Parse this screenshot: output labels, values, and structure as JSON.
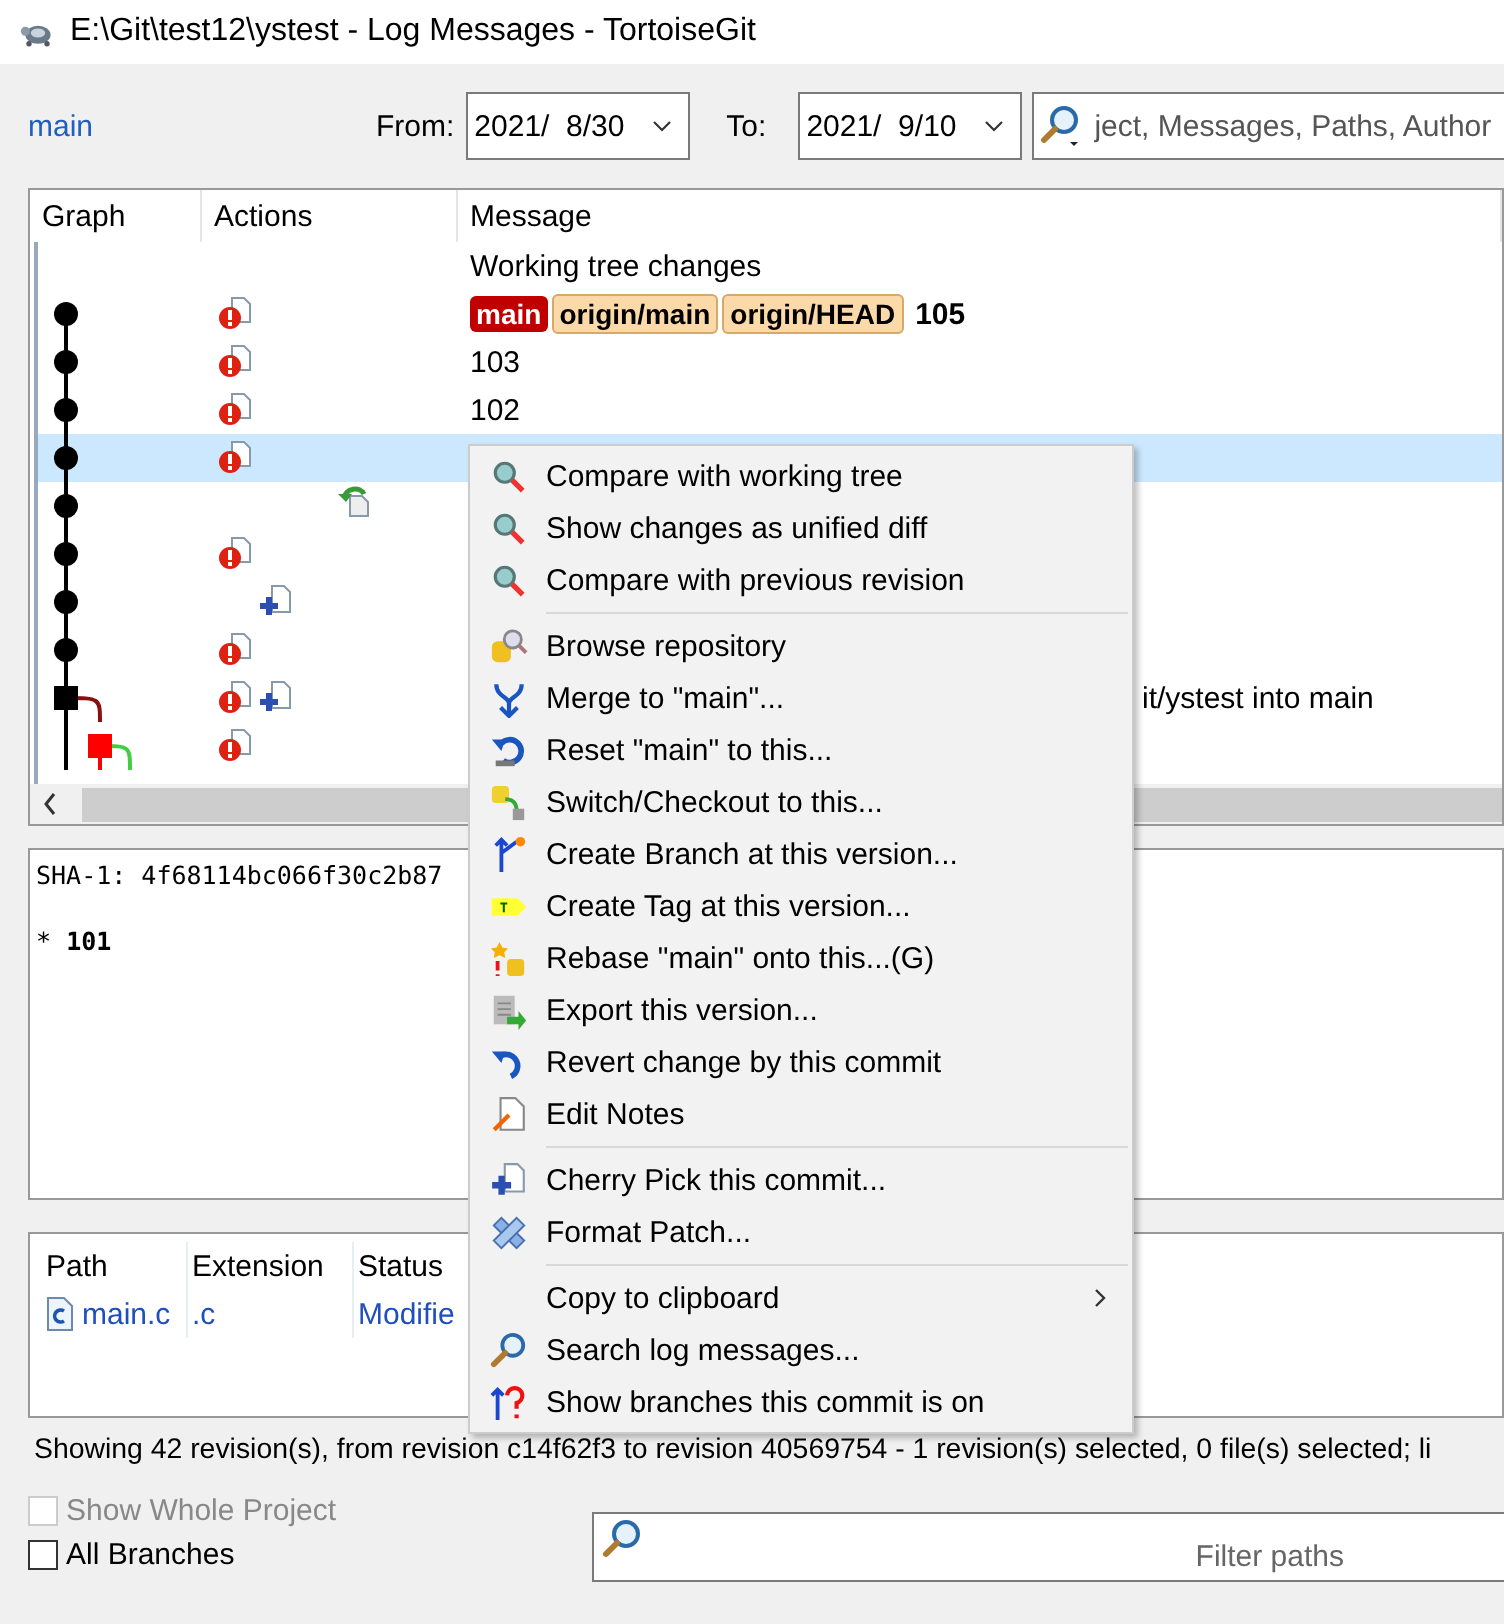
{
  "window": {
    "title": "E:\\Git\\test12\\ystest - Log Messages - TortoiseGit"
  },
  "toolbar": {
    "branch": "main",
    "from_label": "From:",
    "from_date": "2021/  8/30",
    "to_label": "To:",
    "to_date": "2021/  9/10",
    "search": {
      "placeholder": "ject, Messages, Paths, Author"
    }
  },
  "log": {
    "columns": [
      "Graph",
      "Actions",
      "Message"
    ],
    "rows": [
      {
        "kind": "working",
        "selected": false,
        "actions": [],
        "message": "Working tree changes",
        "refs": []
      },
      {
        "kind": "dot",
        "selected": false,
        "actions": [
          {
            "kind": "modify"
          }
        ],
        "message": "105",
        "refs": [
          {
            "label": "main",
            "kind": "local"
          },
          {
            "label": "origin/main",
            "kind": "remote"
          },
          {
            "label": "origin/HEAD",
            "kind": "remote"
          }
        ]
      },
      {
        "kind": "dot",
        "selected": false,
        "actions": [
          {
            "kind": "modify"
          }
        ],
        "message": "103",
        "refs": []
      },
      {
        "kind": "dot",
        "selected": false,
        "actions": [
          {
            "kind": "modify"
          }
        ],
        "message": "102",
        "refs": []
      },
      {
        "kind": "dot",
        "selected": true,
        "actions": [
          {
            "kind": "modify"
          }
        ],
        "refs": []
      },
      {
        "kind": "dot",
        "selected": false,
        "actions": [
          {
            "kind": "revert"
          }
        ],
        "refs": []
      },
      {
        "kind": "dot",
        "selected": false,
        "actions": [
          {
            "kind": "modify"
          }
        ],
        "refs": []
      },
      {
        "kind": "dot",
        "selected": false,
        "actions": [
          {
            "kind": "add"
          }
        ],
        "refs": []
      },
      {
        "kind": "dot",
        "selected": false,
        "actions": [
          {
            "kind": "modify"
          }
        ],
        "refs": []
      },
      {
        "kind": "merge",
        "selected": false,
        "actions": [
          {
            "kind": "modify"
          },
          {
            "kind": "add"
          }
        ],
        "message_tail": "it/ystest into main",
        "refs": []
      },
      {
        "kind": "branch-merge",
        "selected": false,
        "actions": [
          {
            "kind": "modify"
          }
        ],
        "refs": []
      }
    ]
  },
  "details": {
    "sha": "SHA-1: 4f68114bc066f30c2b87",
    "body": "* **101**"
  },
  "files": {
    "columns": [
      "Path",
      "Extension",
      "Status"
    ],
    "rows": [
      {
        "path": "main.c",
        "extension": ".c",
        "status": "Modifie"
      }
    ]
  },
  "status_bar": "Showing 42 revision(s), from revision c14f62f3 to revision 40569754 - 1 revision(s) selected, 0 file(s) selected; li",
  "options": [
    {
      "label": "Show Whole Project",
      "checked": false,
      "disabled": true
    },
    {
      "label": "All Branches",
      "checked": false,
      "disabled": false
    }
  ],
  "filter": {
    "placeholder": "Filter paths"
  },
  "context_menu": {
    "groups": [
      [
        {
          "label": "Compare with working tree"
        },
        {
          "label": "Show changes as unified diff"
        },
        {
          "label": "Compare with previous revision"
        }
      ],
      [
        {
          "label": "Browse repository"
        },
        {
          "label": "Merge to \"main\"..."
        },
        {
          "label": "Reset \"main\" to this..."
        },
        {
          "label": "Switch/Checkout to this..."
        },
        {
          "label": "Create Branch at this version..."
        },
        {
          "label": "Create Tag at this version..."
        },
        {
          "label": "Rebase \"main\" onto this...(G)"
        },
        {
          "label": "Export this version..."
        },
        {
          "label": "Revert change by this commit"
        },
        {
          "label": "Edit Notes"
        }
      ],
      [
        {
          "label": "Cherry Pick this commit..."
        },
        {
          "label": "Format Patch..."
        }
      ],
      [
        {
          "label": "Copy to clipboard",
          "submenu": true
        },
        {
          "label": "Search log messages..."
        },
        {
          "label": "Show branches this commit is on"
        }
      ]
    ]
  }
}
